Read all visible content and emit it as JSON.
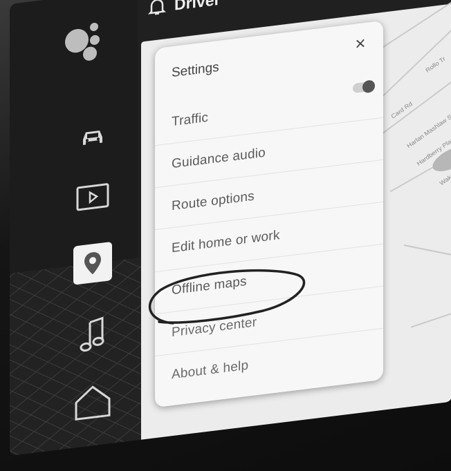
{
  "header": {
    "profile_label": "Driver",
    "icon": "bell-icon"
  },
  "rail": {
    "items": [
      {
        "name": "assistant",
        "icon": "assistant-icon"
      },
      {
        "name": "car",
        "icon": "car-icon"
      },
      {
        "name": "media",
        "icon": "play-icon"
      },
      {
        "name": "maps",
        "icon": "maps-pin-icon",
        "selected": true
      },
      {
        "name": "music",
        "icon": "music-note-icon"
      },
      {
        "name": "home",
        "icon": "home-icon"
      }
    ]
  },
  "settings": {
    "title": "Settings",
    "close_glyph": "×",
    "items": [
      {
        "label": "Traffic",
        "has_toggle": true
      },
      {
        "label": "Guidance audio"
      },
      {
        "label": "Route options"
      },
      {
        "label": "Edit home or work"
      },
      {
        "label": "Offline maps",
        "circled": true
      },
      {
        "label": "Privacy center"
      },
      {
        "label": "About & help"
      }
    ]
  },
  "map_labels": [
    "Card Rd",
    "Harlan Mashlaw St",
    "Hardberry Plaza",
    "Wakemo",
    "Rollo Tr"
  ],
  "colors": {
    "panel_bg": "#f7f7f7",
    "map_bg": "#ececec",
    "frame": "#1a1a1a"
  }
}
